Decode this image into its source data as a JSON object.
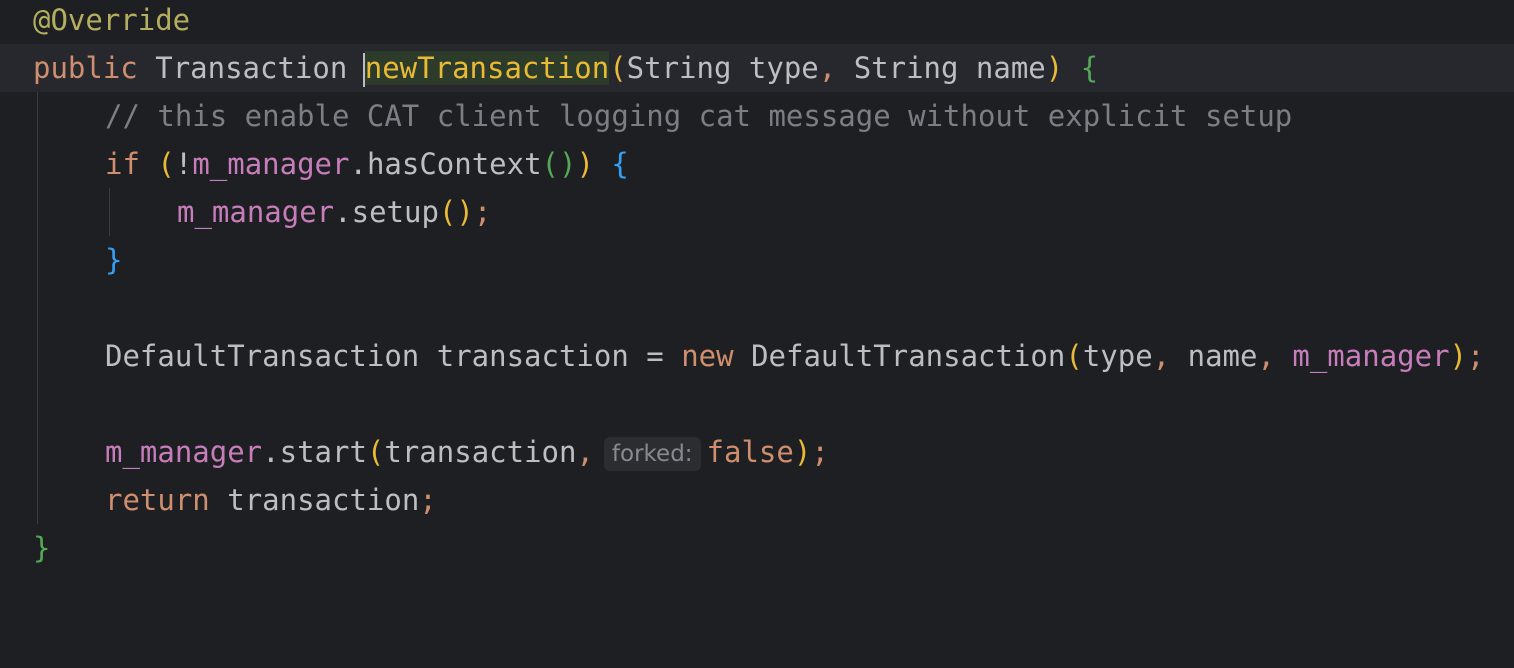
{
  "editor": {
    "lines": {
      "l1": {
        "annotation": "@Override"
      },
      "l2": {
        "kw_public": "public",
        "ret_type": "Transaction",
        "method_name": "newTransaction",
        "open_paren": "(",
        "type1": "String",
        "param1": "type",
        "comma": ",",
        "type2": "String",
        "param2": "name",
        "close_paren": ")",
        "open_brace": "{"
      },
      "l3": {
        "comment": "// this enable CAT client logging cat message without explicit setup"
      },
      "l4": {
        "kw_if": "if",
        "open_paren": "(",
        "bang": "!",
        "field": "m_manager",
        "dot": ".",
        "method": "hasContext",
        "call_parens": "()",
        "close_paren": ")",
        "open_brace": "{"
      },
      "l5": {
        "field": "m_manager",
        "dot": ".",
        "method": "setup",
        "call_parens": "()",
        "semi": ";"
      },
      "l6": {
        "close_brace": "}"
      },
      "l8": {
        "type": "DefaultTransaction",
        "var": "transaction",
        "eq": "=",
        "kw_new": "new",
        "ctor": "DefaultTransaction",
        "open_paren": "(",
        "arg1": "type",
        "comma1": ",",
        "arg2": "name",
        "comma2": ",",
        "arg3": "m_manager",
        "close_paren": ")",
        "semi": ";"
      },
      "l10": {
        "field": "m_manager",
        "dot": ".",
        "method": "start",
        "open_paren": "(",
        "arg1": "transaction",
        "comma": ",",
        "hint": "forked:",
        "arg2": "false",
        "close_paren": ")",
        "semi": ";"
      },
      "l11": {
        "kw_return": "return",
        "var": "transaction",
        "semi": ";"
      },
      "l12": {
        "close_brace": "}"
      }
    }
  }
}
